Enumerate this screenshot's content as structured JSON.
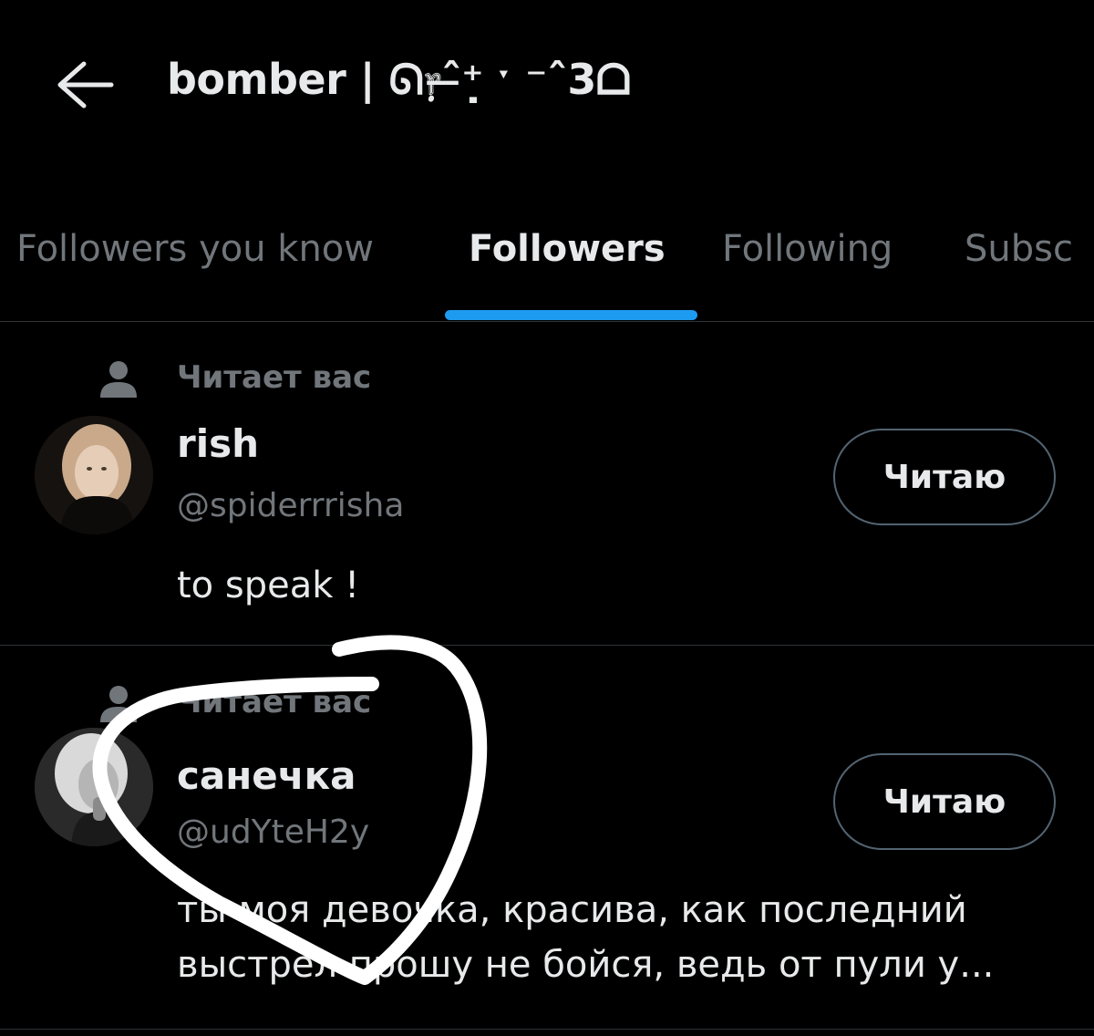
{
  "header": {
    "title": "bomber | ᘏ᥅ˆ̶⁺̣ ˑ ⁻ˆ3ᗝ",
    "back_icon": "arrow-left-icon"
  },
  "tabs": [
    {
      "label": "Followers you know",
      "active": false
    },
    {
      "label": "Followers",
      "active": true
    },
    {
      "label": "Following",
      "active": false
    },
    {
      "label": "Subsc",
      "active": false
    }
  ],
  "accent_color": "#1d9bf0",
  "users": [
    {
      "follows_you_label": "Читает вас",
      "follows_you_icon": "person-icon",
      "display_name": "rish",
      "handle": "@spiderrrisha",
      "bio": "to speak !",
      "button_label": "Читаю"
    },
    {
      "follows_you_label": "Читает вас",
      "follows_you_icon": "person-icon",
      "display_name": "санечка",
      "handle": "@udYteH2y",
      "bio": "ты моя девочка, красива, как последний выстрел прошу не бойся, ведь от пули у...",
      "button_label": "Читаю"
    }
  ]
}
